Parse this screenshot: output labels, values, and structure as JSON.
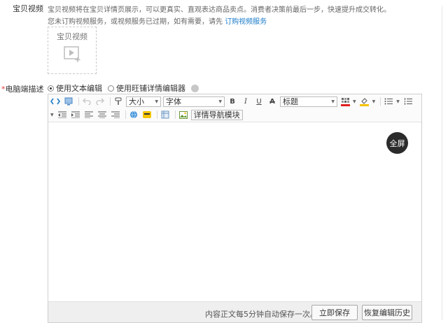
{
  "video": {
    "label": "宝贝视频",
    "desc_line1": "宝贝视频将在宝贝详情页展示，可以更真实、直观表达商品卖点。消费者决策前最后一步，快速提升成交转化。",
    "desc_line2_prefix": "您未订购视频服务，或视频服务已过期，如有需要，请先",
    "subscribe_link": "订购视频服务",
    "upload_box_title": "宝贝视频",
    "upload_icon": "video-add-icon"
  },
  "description": {
    "required_mark": "*",
    "label": "电脑端描述",
    "modes": [
      {
        "label": "使用文本编辑",
        "selected": true
      },
      {
        "label": "使用旺铺详情编辑器",
        "selected": false
      }
    ],
    "help_icon": "help-dot-icon"
  },
  "toolbar": {
    "size_select": "大小",
    "font_select": "字体",
    "bold": "B",
    "italic": "I",
    "underline": "U",
    "strike": "A",
    "heading_select": "标题",
    "nav_module_button": "详情导航模块",
    "font_color": "#e02020",
    "highlight_color": "#f5c400"
  },
  "editor": {
    "fullscreen_label": "全屏",
    "content": ""
  },
  "footer": {
    "autosave_text": "内容正文每5分钟自动保存一次。",
    "save_now": "立即保存",
    "restore_history": "恢复编辑历史"
  }
}
